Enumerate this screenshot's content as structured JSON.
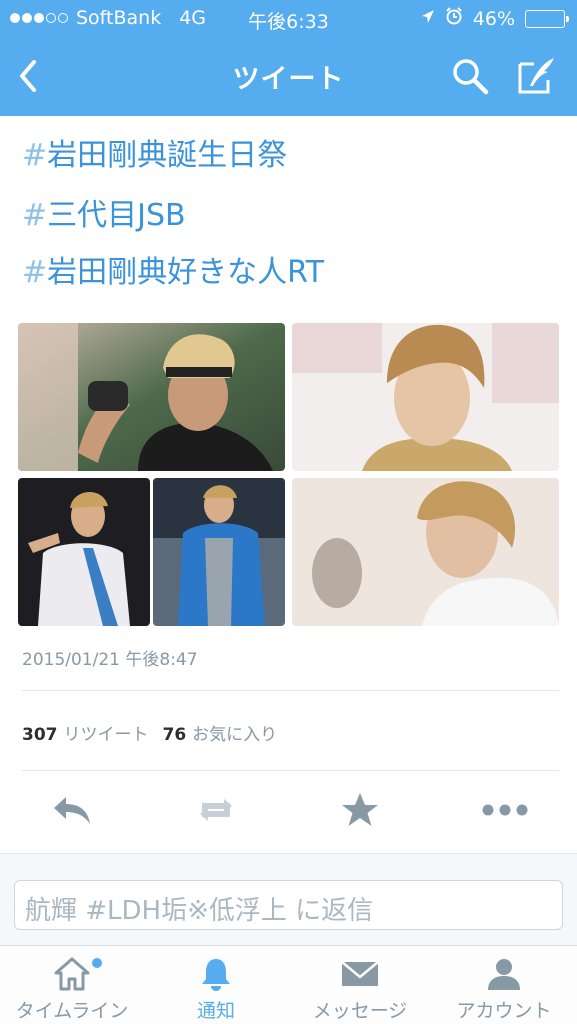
{
  "status_bar": {
    "carrier": "SoftBank",
    "network": "4G",
    "time": "午後6:33",
    "battery": "46%",
    "battery_level": 0.46,
    "signal_bars": 3
  },
  "nav": {
    "title": "ツイート",
    "icons": [
      "back-chevron-icon",
      "search-icon",
      "compose-icon"
    ]
  },
  "tweet": {
    "hashtags": [
      {
        "hash": "#",
        "text": "岩田剛典誕生日祭"
      },
      {
        "hash": "#",
        "text": "三代目JSB"
      },
      {
        "hash": "#",
        "text": "岩田剛典好きな人RT"
      }
    ],
    "timestamp": "2015/01/21 午後8:47",
    "retweets": {
      "count": "307",
      "label": "リツイート"
    },
    "favorites": {
      "count": "76",
      "label": "お気に入り"
    }
  },
  "actions": [
    "reply-icon",
    "retweet-icon",
    "favorite-icon",
    "more-icon"
  ],
  "reply": {
    "placeholder": "航輝 #LDH垢※低浮上 に返信"
  },
  "tabbar": {
    "items": [
      {
        "label": "タイムライン",
        "icon": "home-icon",
        "active": false,
        "badge": true
      },
      {
        "label": "通知",
        "icon": "bell-icon",
        "active": true
      },
      {
        "label": "メッセージ",
        "icon": "envelope-icon",
        "active": false
      },
      {
        "label": "アカウント",
        "icon": "person-icon",
        "active": false
      }
    ]
  },
  "colors": {
    "brand": "#55acee",
    "link": "#3b94d9",
    "muted": "#8899a6"
  }
}
